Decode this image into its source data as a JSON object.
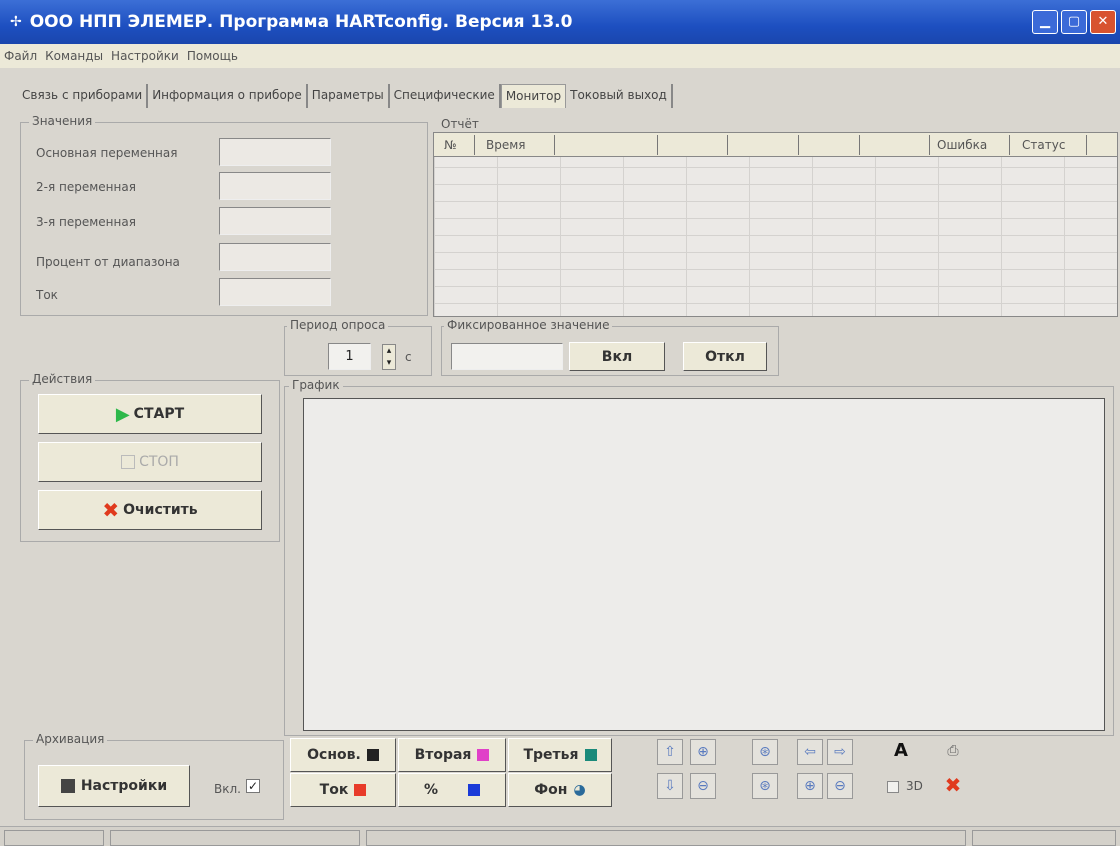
{
  "window": {
    "title": "ООО НПП ЭЛЕМЕР.  Программа HARTconfig. Версия 13.0"
  },
  "menu": [
    "Файл",
    "Команды",
    "Настройки",
    "Помощь"
  ],
  "tabs": [
    {
      "label": "Связь с приборами"
    },
    {
      "label": "Информация о приборе"
    },
    {
      "label": "Параметры"
    },
    {
      "label": "Специфические"
    },
    {
      "label": "Монитор",
      "active": true
    },
    {
      "label": "Токовый выход"
    }
  ],
  "values": {
    "legend": "Значения",
    "rows": [
      {
        "label": "Основная переменная",
        "value": ""
      },
      {
        "label": "2-я переменная",
        "value": ""
      },
      {
        "label": "3-я переменная",
        "value": ""
      },
      {
        "label": "Процент от диапазона",
        "value": ""
      },
      {
        "label": "Ток",
        "value": ""
      }
    ]
  },
  "report": {
    "legend": "Отчёт",
    "columns": [
      "№",
      "Время",
      "",
      "",
      "",
      "",
      "",
      "Ошибка",
      "Статус"
    ]
  },
  "poll": {
    "legend": "Период опроса",
    "value": "1",
    "unit": "с"
  },
  "fixed": {
    "legend": "Фиксированное значение",
    "value": "",
    "on_label": "Вкл",
    "off_label": "Откл"
  },
  "actions": {
    "legend": "Действия",
    "start_label": "СТАРТ",
    "stop_label": "СТОП",
    "clear_label": "Очистить"
  },
  "graph": {
    "legend": "График"
  },
  "archive": {
    "legend": "Архивация",
    "settings_label": "Настройки",
    "enabled_label": "Вкл.",
    "enabled": true
  },
  "series_buttons": {
    "main": {
      "label": "Основ.",
      "color": "#222222"
    },
    "second": {
      "label": "Вторая",
      "color": "#e040c8"
    },
    "third": {
      "label": "Третья",
      "color": "#1a8a7a"
    },
    "current": {
      "label": "Ток",
      "color": "#e83b2a"
    },
    "percent": {
      "label": "%",
      "color": "#1a3ad8"
    },
    "background": {
      "label": "Фон",
      "color": "#2a6a9a"
    }
  },
  "toolbar": {
    "text_label": "A",
    "three_d_label": "3D"
  }
}
